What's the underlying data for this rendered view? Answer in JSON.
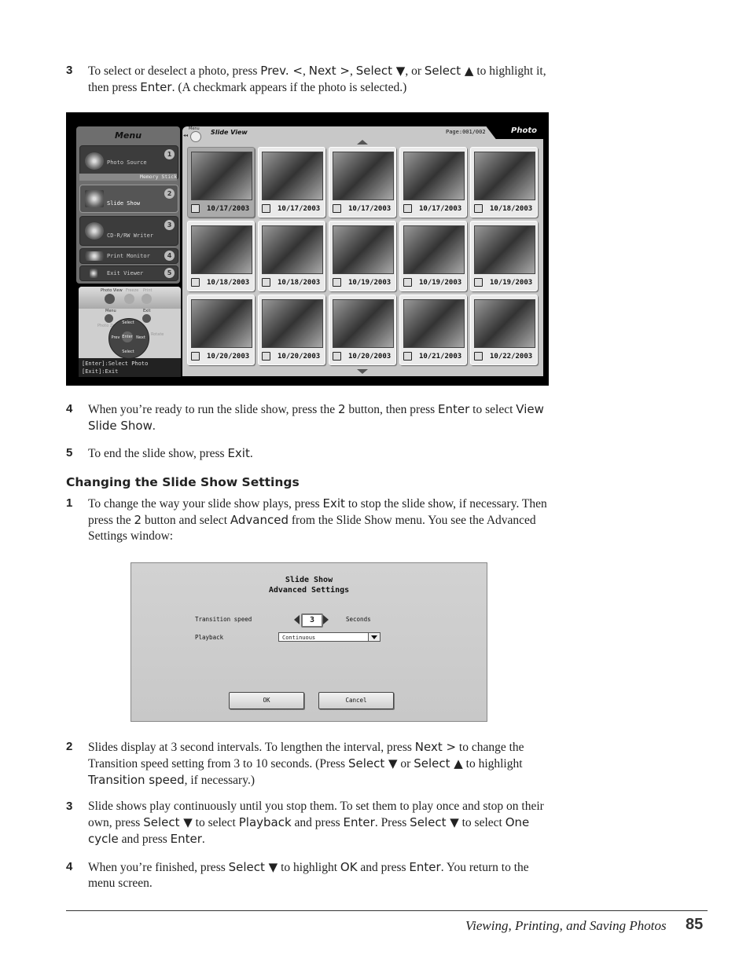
{
  "steps_top": {
    "step3": {
      "number": "3",
      "parts": [
        "To select or deselect a photo, press ",
        "Prev. <",
        ", ",
        "Next >",
        ", ",
        "Select ▼",
        ", or ",
        "Select ▲",
        " to highlight it, then press ",
        "Enter",
        ". (A checkmark appears if the photo is selected.)"
      ]
    },
    "step4": {
      "number": "4",
      "parts": [
        "When you’re ready to run the slide show, press the ",
        "2",
        " button, then press ",
        "Enter",
        " to select ",
        "View Slide Show",
        "."
      ]
    },
    "step5": {
      "number": "5",
      "parts": [
        "To end the slide show, press ",
        "Exit",
        "."
      ]
    }
  },
  "section_heading": "Changing the Slide Show Settings",
  "steps_settings": {
    "step1": {
      "number": "1",
      "parts": [
        "To change the way your slide show plays, press ",
        "Exit",
        " to stop the slide show, if necessary. Then press the ",
        "2",
        " button and select ",
        "Advanced",
        " from the Slide Show menu. You see the Advanced Settings window:"
      ]
    },
    "step2": {
      "number": "2",
      "parts": [
        "Slides display at 3 second intervals. To lengthen the interval, press ",
        "Next >",
        " to change the Transition speed setting from 3 to 10 seconds. (Press ",
        "Select ▼",
        " or ",
        "Select ▲",
        " to highlight ",
        "Transition speed",
        ", if necessary.)"
      ]
    },
    "step3": {
      "number": "3",
      "parts": [
        "Slide shows play continuously until you stop them. To set them to play once and stop on their own, press ",
        "Select ▼",
        " to select ",
        "Playback",
        " and press ",
        "Enter",
        ". Press ",
        "Select ▼",
        " to select ",
        "One cycle",
        " and press ",
        "Enter",
        "."
      ]
    },
    "step4": {
      "number": "4",
      "parts": [
        "When you’re finished, press ",
        "Select ▼",
        " to highlight ",
        "OK",
        " and press ",
        "Enter",
        ". You return to the menu screen."
      ]
    }
  },
  "slide_view_screen": {
    "menu": {
      "title": "Menu",
      "items": [
        {
          "label": "Photo Source",
          "number": "1",
          "sub": "Memory Stick"
        },
        {
          "label": "Slide Show",
          "number": "2"
        },
        {
          "label": "CD-R/RW Writer",
          "number": "3"
        },
        {
          "label": "Print Monitor",
          "number": "4"
        },
        {
          "label": "Exit Viewer",
          "number": "5"
        }
      ]
    },
    "remote": {
      "labels": {
        "photo_view": "Photo View",
        "freeze": "Freeze",
        "print": "Print",
        "menu": "Menu",
        "exit": "Exit",
        "photo_zoom": "Photo Zoom",
        "rotate": "Rotate",
        "select_up": "Select",
        "select_down": "Select",
        "prev": "Prev",
        "next": "Next",
        "enter": "Enter"
      }
    },
    "help": [
      "[Enter]:Select Photo",
      "[Exit]:Exit"
    ],
    "header": {
      "menu_label": "Menu",
      "back_icon": "◂◂",
      "title": "Slide View",
      "page": "Page:001/002",
      "tab": "Photo"
    },
    "thumbnails": [
      {
        "date": "10/17/2003",
        "selected": false
      },
      {
        "date": "10/17/2003",
        "selected": true
      },
      {
        "date": "10/17/2003",
        "selected": true
      },
      {
        "date": "10/17/2003",
        "selected": true
      },
      {
        "date": "10/18/2003",
        "selected": true
      },
      {
        "date": "10/18/2003",
        "selected": true
      },
      {
        "date": "10/18/2003",
        "selected": true
      },
      {
        "date": "10/19/2003",
        "selected": true
      },
      {
        "date": "10/19/2003",
        "selected": true
      },
      {
        "date": "10/19/2003",
        "selected": true
      },
      {
        "date": "10/20/2003",
        "selected": true
      },
      {
        "date": "10/20/2003",
        "selected": true
      },
      {
        "date": "10/20/2003",
        "selected": true
      },
      {
        "date": "10/21/2003",
        "selected": true
      },
      {
        "date": "10/22/2003",
        "selected": true
      }
    ]
  },
  "advanced_settings_screen": {
    "title_line1": "Slide Show",
    "title_line2": "Advanced Settings",
    "transition_label": "Transition speed",
    "transition_value": "3",
    "transition_unit": "Seconds",
    "playback_label": "Playback",
    "playback_value": "Continuous",
    "ok_label": "OK",
    "cancel_label": "Cancel"
  },
  "footer": {
    "title": "Viewing, Printing, and Saving Photos",
    "page": "85"
  }
}
